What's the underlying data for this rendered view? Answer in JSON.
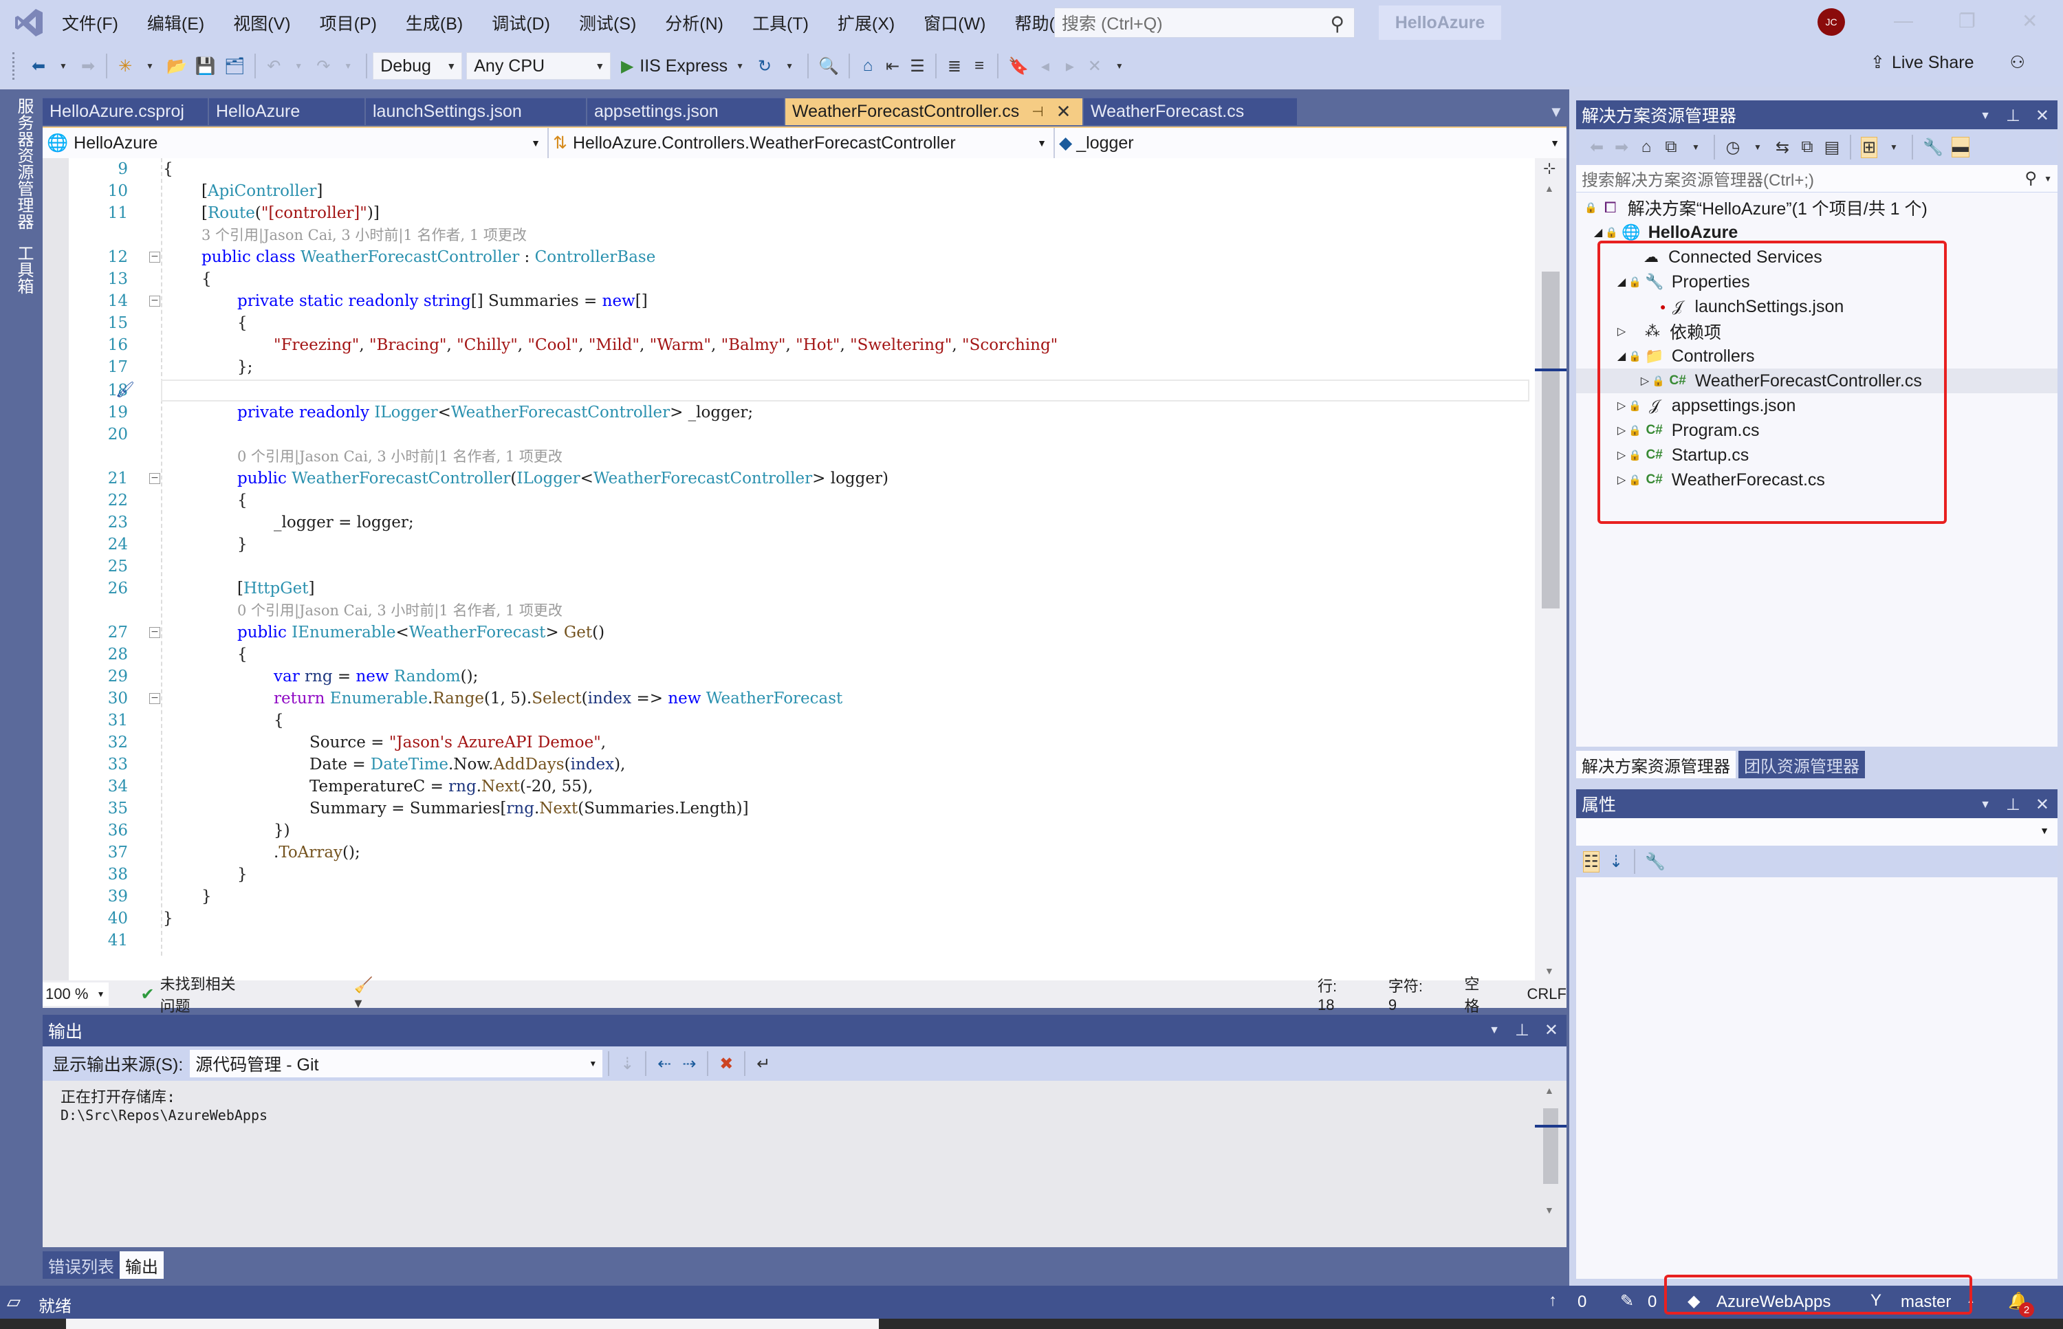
{
  "menu": [
    "文件(F)",
    "编辑(E)",
    "视图(V)",
    "项目(P)",
    "生成(B)",
    "调试(D)",
    "测试(S)",
    "分析(N)",
    "工具(T)",
    "扩展(X)",
    "窗口(W)",
    "帮助(H)"
  ],
  "search": {
    "placeholder": "搜索 (Ctrl+Q)"
  },
  "solution_name": "HelloAzure",
  "user_initials": "JC",
  "toolbar": {
    "config": "Debug",
    "platform": "Any CPU",
    "run_target": "IIS Express",
    "live_share": "Live Share"
  },
  "left_strip": {
    "server_explorer": "服务器资源管理器",
    "toolbox": "工具箱"
  },
  "tabs": [
    {
      "label": "HelloAzure.csproj"
    },
    {
      "label": "HelloAzure"
    },
    {
      "label": "launchSettings.json"
    },
    {
      "label": "appsettings.json"
    },
    {
      "label": "WeatherForecastController.cs",
      "active": true
    },
    {
      "label": "WeatherForecast.cs"
    }
  ],
  "navbar": {
    "project": "HelloAzure",
    "type": "HelloAzure.Controllers.WeatherForecastController",
    "member": "_logger"
  },
  "code": {
    "codelens_class": "3 个引用|Jason Cai, 3 小时前|1 名作者, 1 项更改",
    "codelens_ctor": "0 个引用|Jason Cai, 3 小时前|1 名作者, 1 项更改",
    "codelens_get": "0 个引用|Jason Cai, 3 小时前|1 名作者, 1 项更改",
    "line_numbers": [
      "9",
      "10",
      "11",
      "12",
      "13",
      "14",
      "15",
      "16",
      "17",
      "18",
      "19",
      "20",
      "21",
      "22",
      "23",
      "24",
      "25",
      "26",
      "27",
      "28",
      "29",
      "30",
      "31",
      "32",
      "33",
      "34",
      "35",
      "36",
      "37",
      "38",
      "39",
      "40",
      "41"
    ],
    "summaries": [
      "Freezing",
      "Bracing",
      "Chilly",
      "Cool",
      "Mild",
      "Warm",
      "Balmy",
      "Hot",
      "Sweltering",
      "Scorching"
    ],
    "source_string": "Jason's AzureAPI Demoe",
    "temp_range": "-20, 55"
  },
  "editor_status": {
    "zoom": "100 %",
    "issues": "未找到相关问题",
    "line": "行: 18",
    "char": "字符: 9",
    "indent": "空格",
    "eol": "CRLF"
  },
  "output": {
    "title": "输出",
    "source_label": "显示输出来源(S):",
    "source_value": "源代码管理 - Git",
    "lines": [
      "正在打开存储库:",
      "D:\\Src\\Repos\\AzureWebApps"
    ]
  },
  "bottom_tabs": [
    {
      "label": "错误列表"
    },
    {
      "label": "输出",
      "active": true
    }
  ],
  "solution_explorer": {
    "title": "解决方案资源管理器",
    "search_placeholder": "搜索解决方案资源管理器(Ctrl+;)",
    "solution_node": "解决方案“HelloAzure”(1 个项目/共 1 个)",
    "project_node": "HelloAzure",
    "items": [
      {
        "label": "Connected Services",
        "icon": "cloud-plug-icon"
      },
      {
        "label": "Properties",
        "icon": "wrench-icon",
        "expanded": true
      },
      {
        "label": "launchSettings.json",
        "icon": "json-file-icon"
      },
      {
        "label": "依赖项",
        "icon": "dependencies-icon"
      },
      {
        "label": "Controllers",
        "icon": "folder-icon",
        "expanded": true
      },
      {
        "label": "WeatherForecastController.cs",
        "icon": "csharp-file-icon",
        "selected": true
      },
      {
        "label": "appsettings.json",
        "icon": "json-file-icon"
      },
      {
        "label": "Program.cs",
        "icon": "csharp-file-icon"
      },
      {
        "label": "Startup.cs",
        "icon": "csharp-file-icon"
      },
      {
        "label": "WeatherForecast.cs",
        "icon": "csharp-file-icon"
      }
    ]
  },
  "side_tabs": [
    {
      "label": "解决方案资源管理器",
      "active": true
    },
    {
      "label": "团队资源管理器"
    }
  ],
  "properties": {
    "title": "属性"
  },
  "statusbar": {
    "ready": "就绪",
    "push_count": "0",
    "changes_count": "0",
    "repo": "AzureWebApps",
    "branch": "master",
    "notifications": "2"
  },
  "colors": {
    "accent": "#40528e",
    "active_tab": "#f5cc84",
    "highlight_box": "#e82020"
  }
}
